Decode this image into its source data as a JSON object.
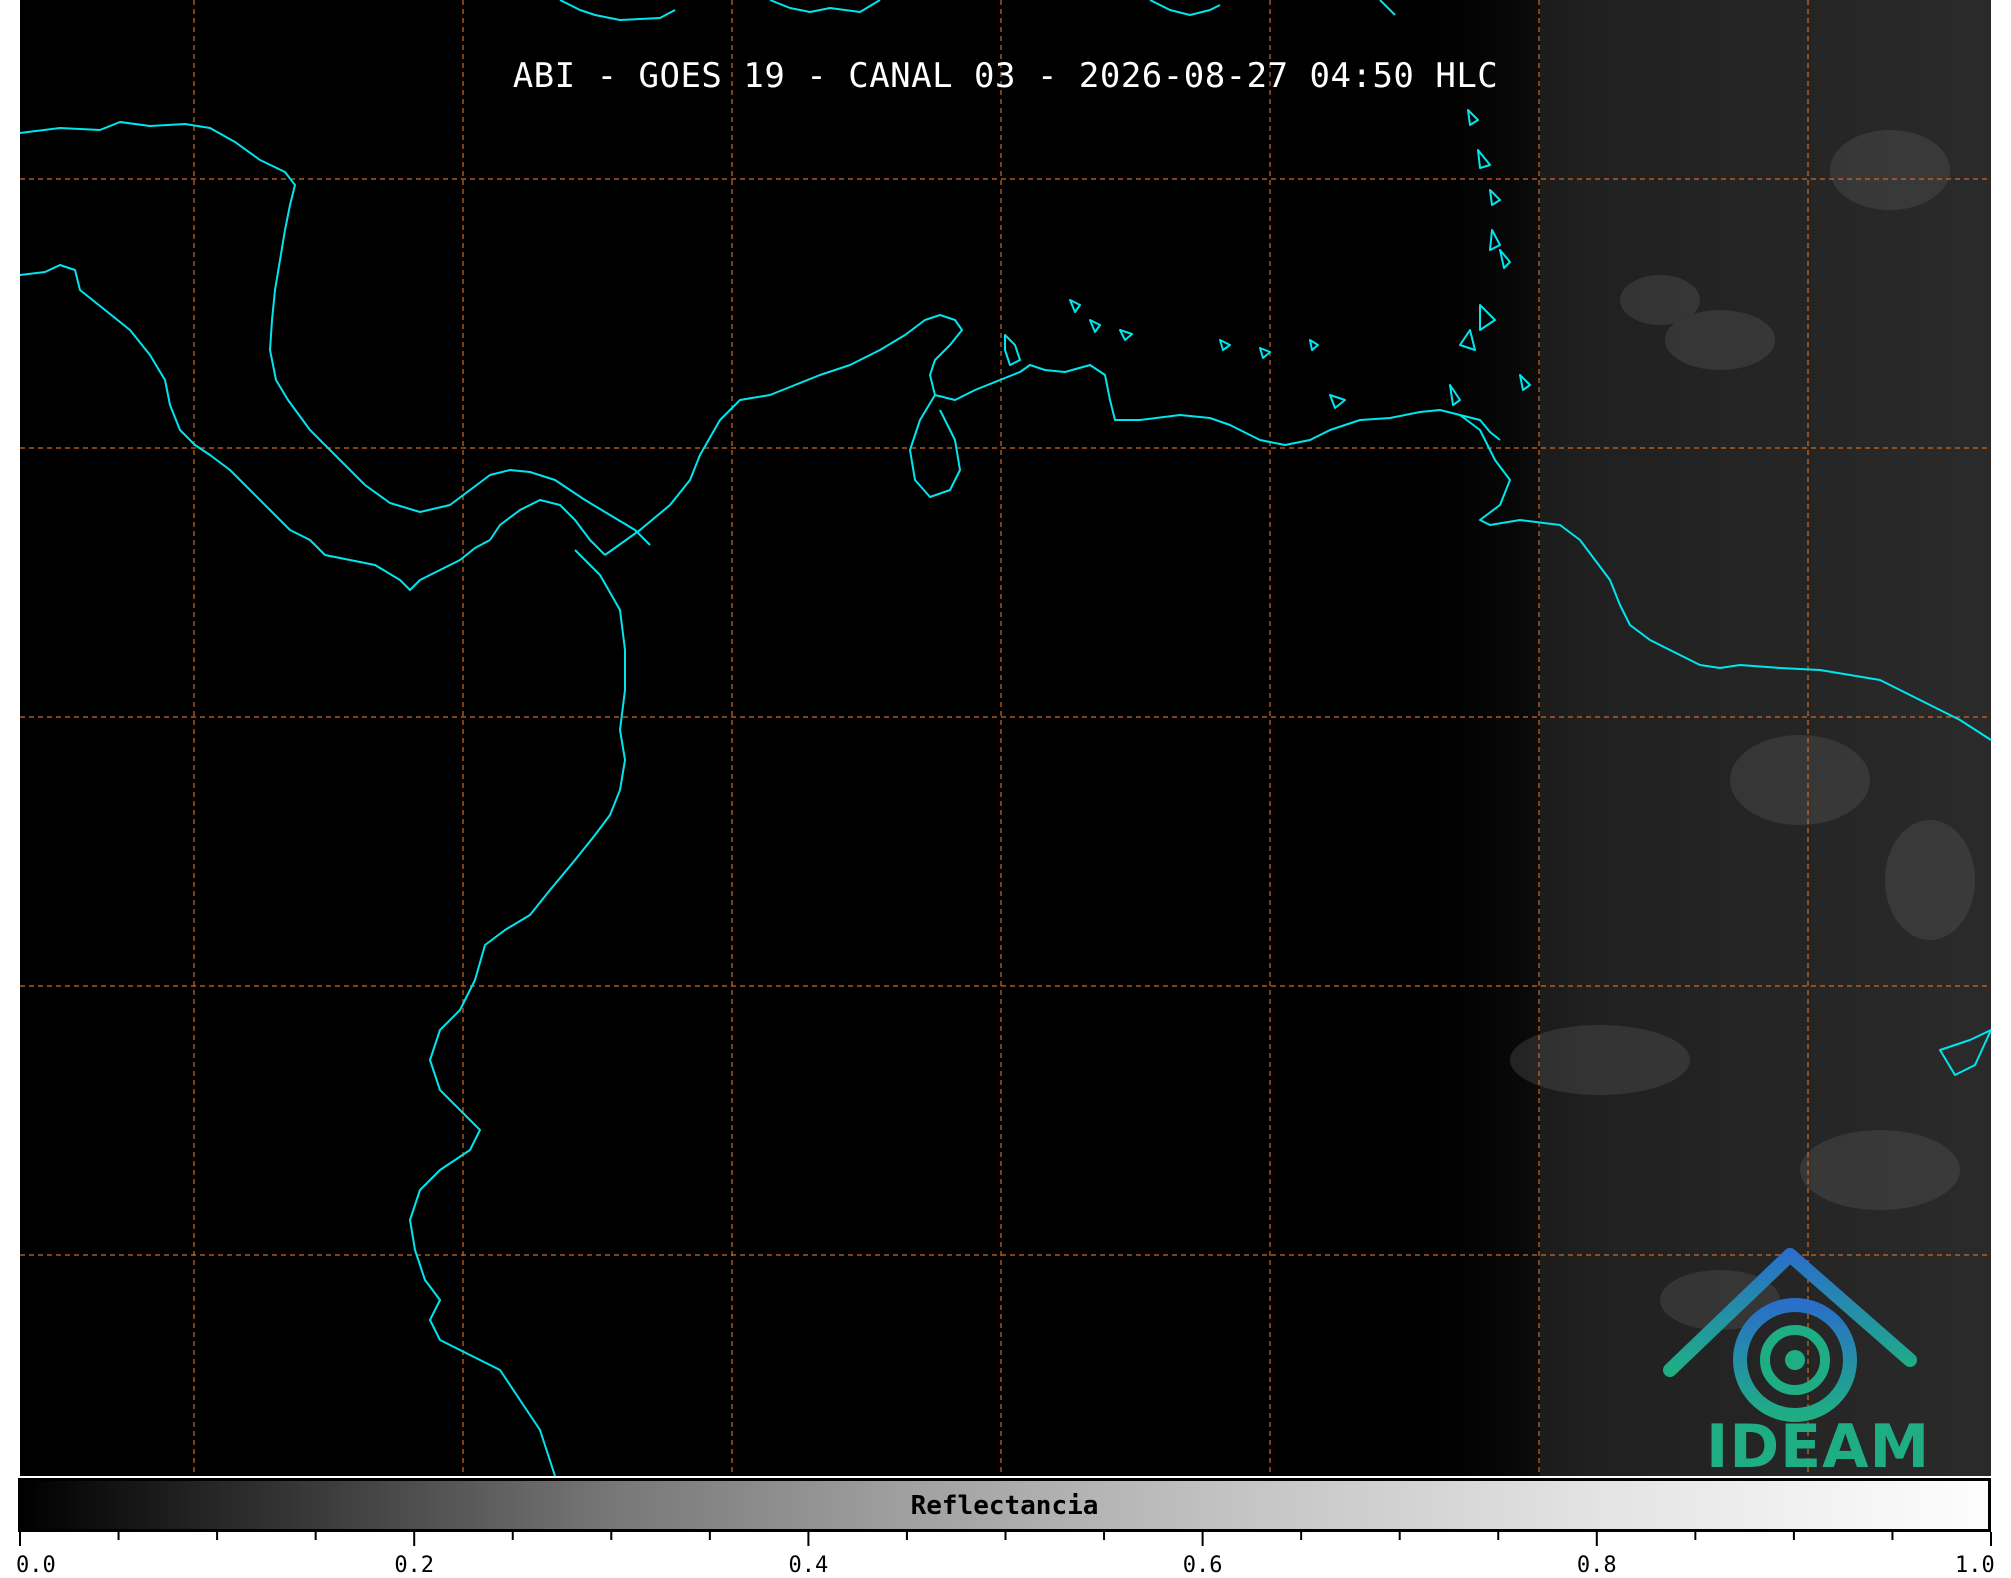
{
  "title": "ABI - GOES 19 - CANAL 03 - 2026-08-27 04:50 HLC",
  "colorbar": {
    "label": "Reflectancia",
    "ticks": [
      "0.0",
      "0.2",
      "0.4",
      "0.6",
      "0.8",
      "1.0"
    ],
    "range": [
      0.0,
      1.0
    ]
  },
  "logo": {
    "text": "IDEAM"
  },
  "colors": {
    "coastline": "#00e5ee",
    "gridline": "#d2691e",
    "logo_blue": "#2a7fc1",
    "logo_green": "#1fae84"
  }
}
